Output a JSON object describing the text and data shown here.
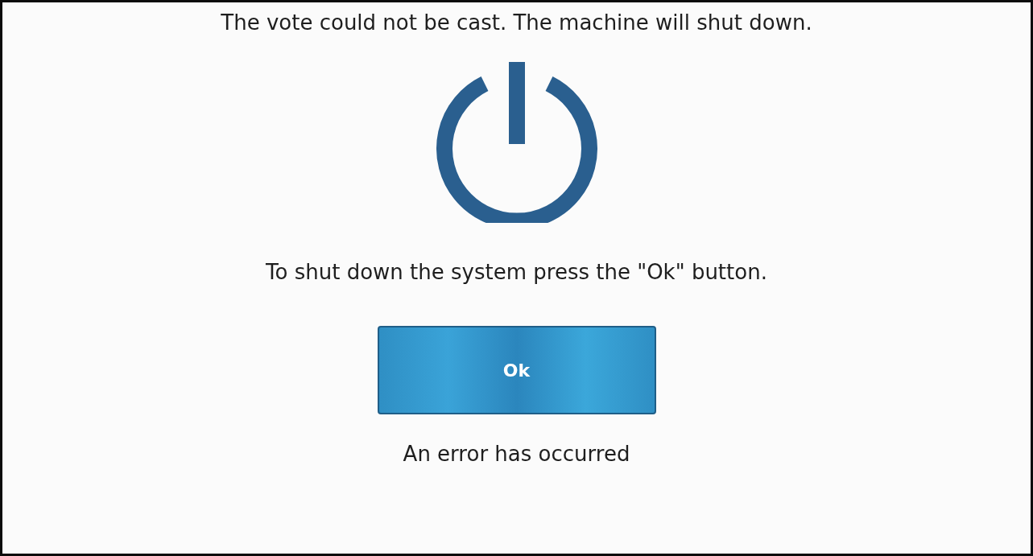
{
  "message": "The vote could not be cast. The machine will shut down.",
  "instruction": "To shut down the system press the \"Ok\" button.",
  "ok_button": {
    "label": "Ok"
  },
  "status": "An error has occurred"
}
